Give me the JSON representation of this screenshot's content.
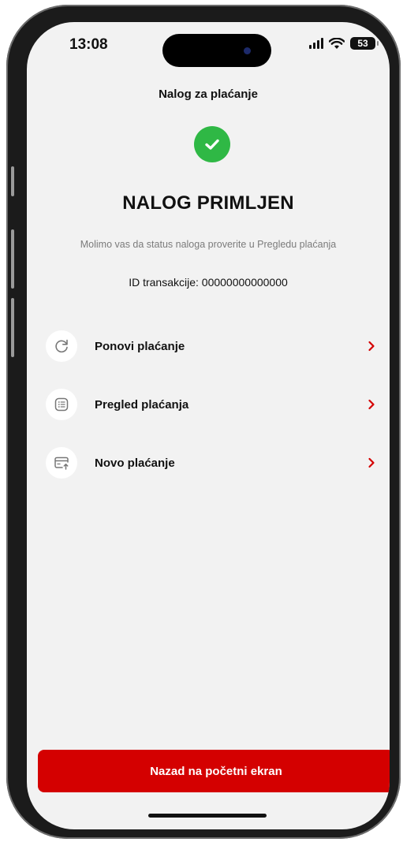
{
  "status_bar": {
    "time": "13:08",
    "battery": "53",
    "icons": [
      "signal-icon",
      "wifi-icon",
      "battery-icon"
    ]
  },
  "header": {
    "title": "Nalog za plaćanje"
  },
  "result": {
    "icon": "check-circle-icon",
    "heading": "NALOG PRIMLJEN",
    "message": "Molimo vas da status naloga proverite u Pregledu plaćanja",
    "transaction_id": "ID transakcije: 00000000000000"
  },
  "actions": [
    {
      "label": "Ponovi plaćanje",
      "icon": "refresh-icon"
    },
    {
      "label": "Pregled plaćanja",
      "icon": "list-icon"
    },
    {
      "label": "Novo plaćanje",
      "icon": "card-upload-icon"
    }
  ],
  "footer": {
    "primary_label": "Nazad na početni ekran"
  },
  "colors": {
    "accent": "#d40000",
    "success": "#2fb845",
    "background": "#f2f2f2"
  }
}
